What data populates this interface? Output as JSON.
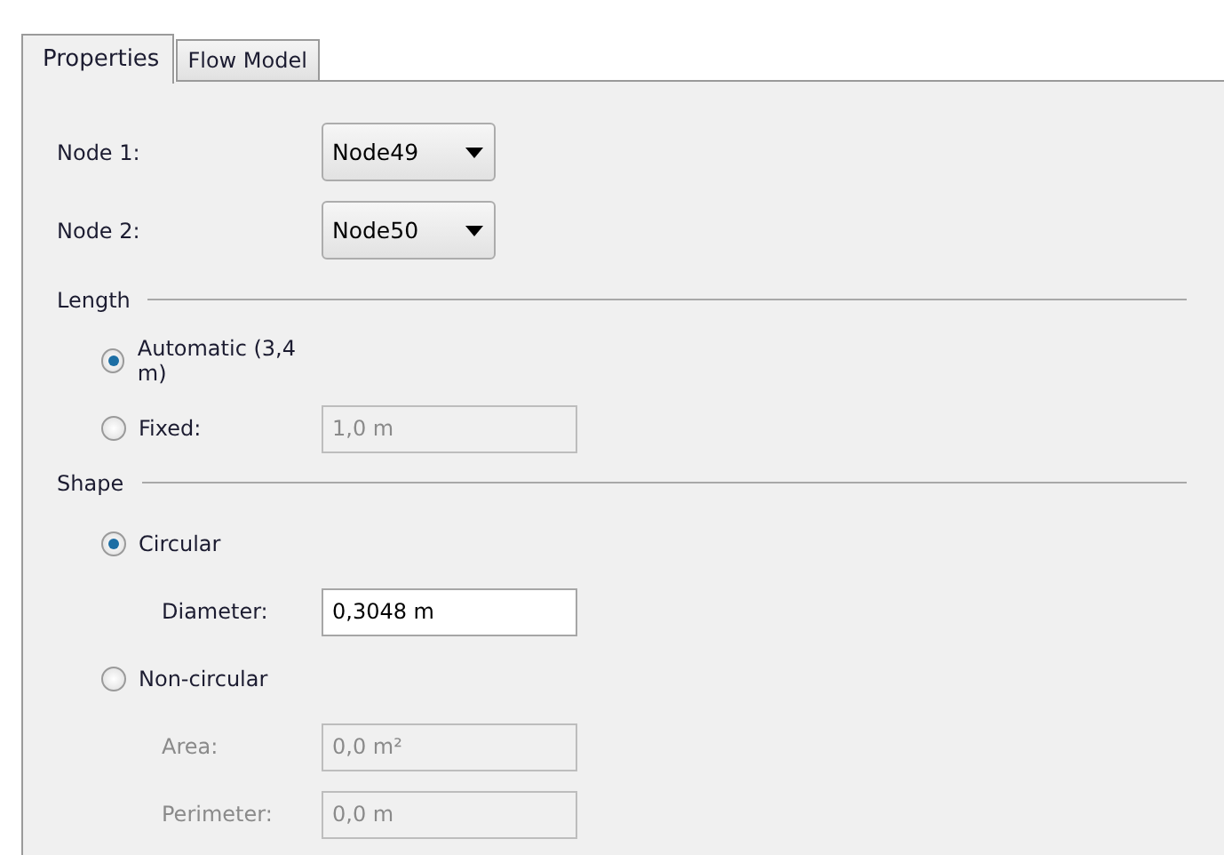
{
  "tabs": [
    {
      "label": "Properties",
      "selected": true
    },
    {
      "label": "Flow Model",
      "selected": false
    }
  ],
  "node_selectors": [
    {
      "label": "Node 1:",
      "value": "Node49"
    },
    {
      "label": "Node 2:",
      "value": "Node50"
    }
  ],
  "sections": [
    {
      "title": "Length",
      "items": [
        {
          "kind": "radio",
          "label": "Automatic (3,4 m)",
          "selected": true
        },
        {
          "kind": "radio",
          "label": "Fixed:",
          "selected": false,
          "value": "1,0 m",
          "disabled": true
        }
      ]
    },
    {
      "title": "Shape",
      "items": [
        {
          "kind": "radio",
          "label": "Circular",
          "selected": true
        },
        {
          "kind": "field",
          "label": "Diameter:",
          "value": "0,3048 m",
          "disabled": false
        },
        {
          "kind": "radio",
          "label": "Non-circular",
          "selected": false
        },
        {
          "kind": "field",
          "label": "Area:",
          "value": "0,0 m²",
          "disabled": true
        },
        {
          "kind": "field",
          "label": "Perimeter:",
          "value": "0,0 m",
          "disabled": true
        }
      ]
    }
  ]
}
